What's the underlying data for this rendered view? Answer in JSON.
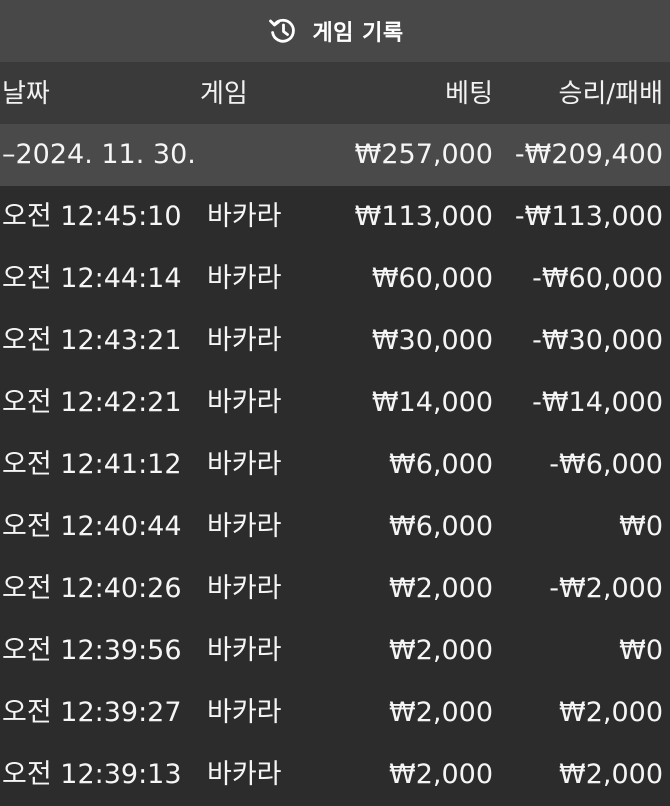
{
  "header": {
    "icon": "history-icon",
    "title": "게임 기록"
  },
  "columns": {
    "date": "날짜",
    "game": "게임",
    "bet": "베팅",
    "result": "승리/패배"
  },
  "summary": {
    "date": "–2024. 11. 30.",
    "bet": "₩257,000",
    "result": "-₩209,400"
  },
  "rows": [
    {
      "time": "오전 12:45:10",
      "game": "바카라",
      "bet": "₩113,000",
      "result": "-₩113,000"
    },
    {
      "time": "오전 12:44:14",
      "game": "바카라",
      "bet": "₩60,000",
      "result": "-₩60,000"
    },
    {
      "time": "오전 12:43:21",
      "game": "바카라",
      "bet": "₩30,000",
      "result": "-₩30,000"
    },
    {
      "time": "오전 12:42:21",
      "game": "바카라",
      "bet": "₩14,000",
      "result": "-₩14,000"
    },
    {
      "time": "오전 12:41:12",
      "game": "바카라",
      "bet": "₩6,000",
      "result": "-₩6,000"
    },
    {
      "time": "오전 12:40:44",
      "game": "바카라",
      "bet": "₩6,000",
      "result": "₩0"
    },
    {
      "time": "오전 12:40:26",
      "game": "바카라",
      "bet": "₩2,000",
      "result": "-₩2,000"
    },
    {
      "time": "오전 12:39:56",
      "game": "바카라",
      "bet": "₩2,000",
      "result": "₩0"
    },
    {
      "time": "오전 12:39:27",
      "game": "바카라",
      "bet": "₩2,000",
      "result": "₩2,000"
    },
    {
      "time": "오전 12:39:13",
      "game": "바카라",
      "bet": "₩2,000",
      "result": "₩2,000"
    }
  ]
}
